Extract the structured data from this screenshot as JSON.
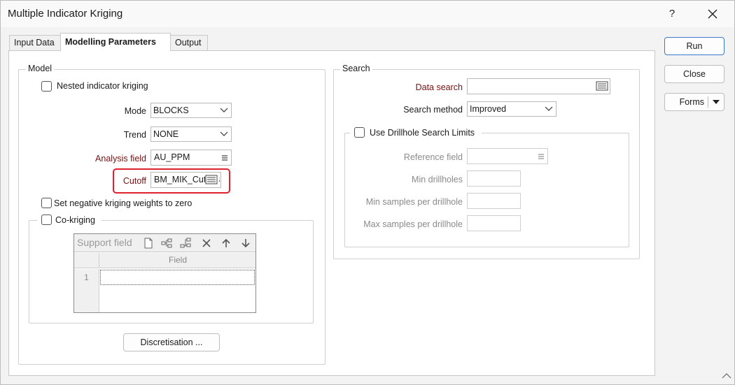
{
  "window": {
    "title": "Multiple Indicator Kriging",
    "help_label": "?",
    "close_label": "✕"
  },
  "tabs": [
    {
      "label": "Input Data"
    },
    {
      "label": "Modelling Parameters"
    },
    {
      "label": "Output"
    }
  ],
  "model": {
    "legend": "Model",
    "nested_label": "Nested indicator kriging",
    "mode": {
      "label": "Mode",
      "value": "BLOCKS"
    },
    "trend": {
      "label": "Trend",
      "value": "NONE"
    },
    "analysis_field": {
      "label": "Analysis field",
      "value": "AU_PPM"
    },
    "cutoff": {
      "label": "Cutoff",
      "value": "BM_MIK_Cutoffs"
    },
    "neg_weights_label": "Set negative kriging weights to zero",
    "cokriging": {
      "label": "Co-kriging",
      "toolbar_label": "Support field",
      "column_header": "Field",
      "rows": [
        "1"
      ]
    },
    "discretisation_label": "Discretisation ..."
  },
  "search": {
    "legend": "Search",
    "data_search": {
      "label": "Data search",
      "value": ""
    },
    "search_method": {
      "label": "Search method",
      "value": "Improved"
    },
    "drillhole_limits": {
      "label": "Use Drillhole Search Limits",
      "reference_field": {
        "label": "Reference field",
        "value": ""
      },
      "min_drillholes": {
        "label": "Min drillholes",
        "value": ""
      },
      "min_samples": {
        "label": "Min samples per drillhole",
        "value": ""
      },
      "max_samples": {
        "label": "Max samples per drillhole",
        "value": ""
      }
    }
  },
  "side_buttons": {
    "run": "Run",
    "close": "Close",
    "forms": "Forms"
  },
  "colors": {
    "highlight": "#e0202c",
    "required_label": "#7a1010",
    "default_button_border": "#3c78c8"
  }
}
